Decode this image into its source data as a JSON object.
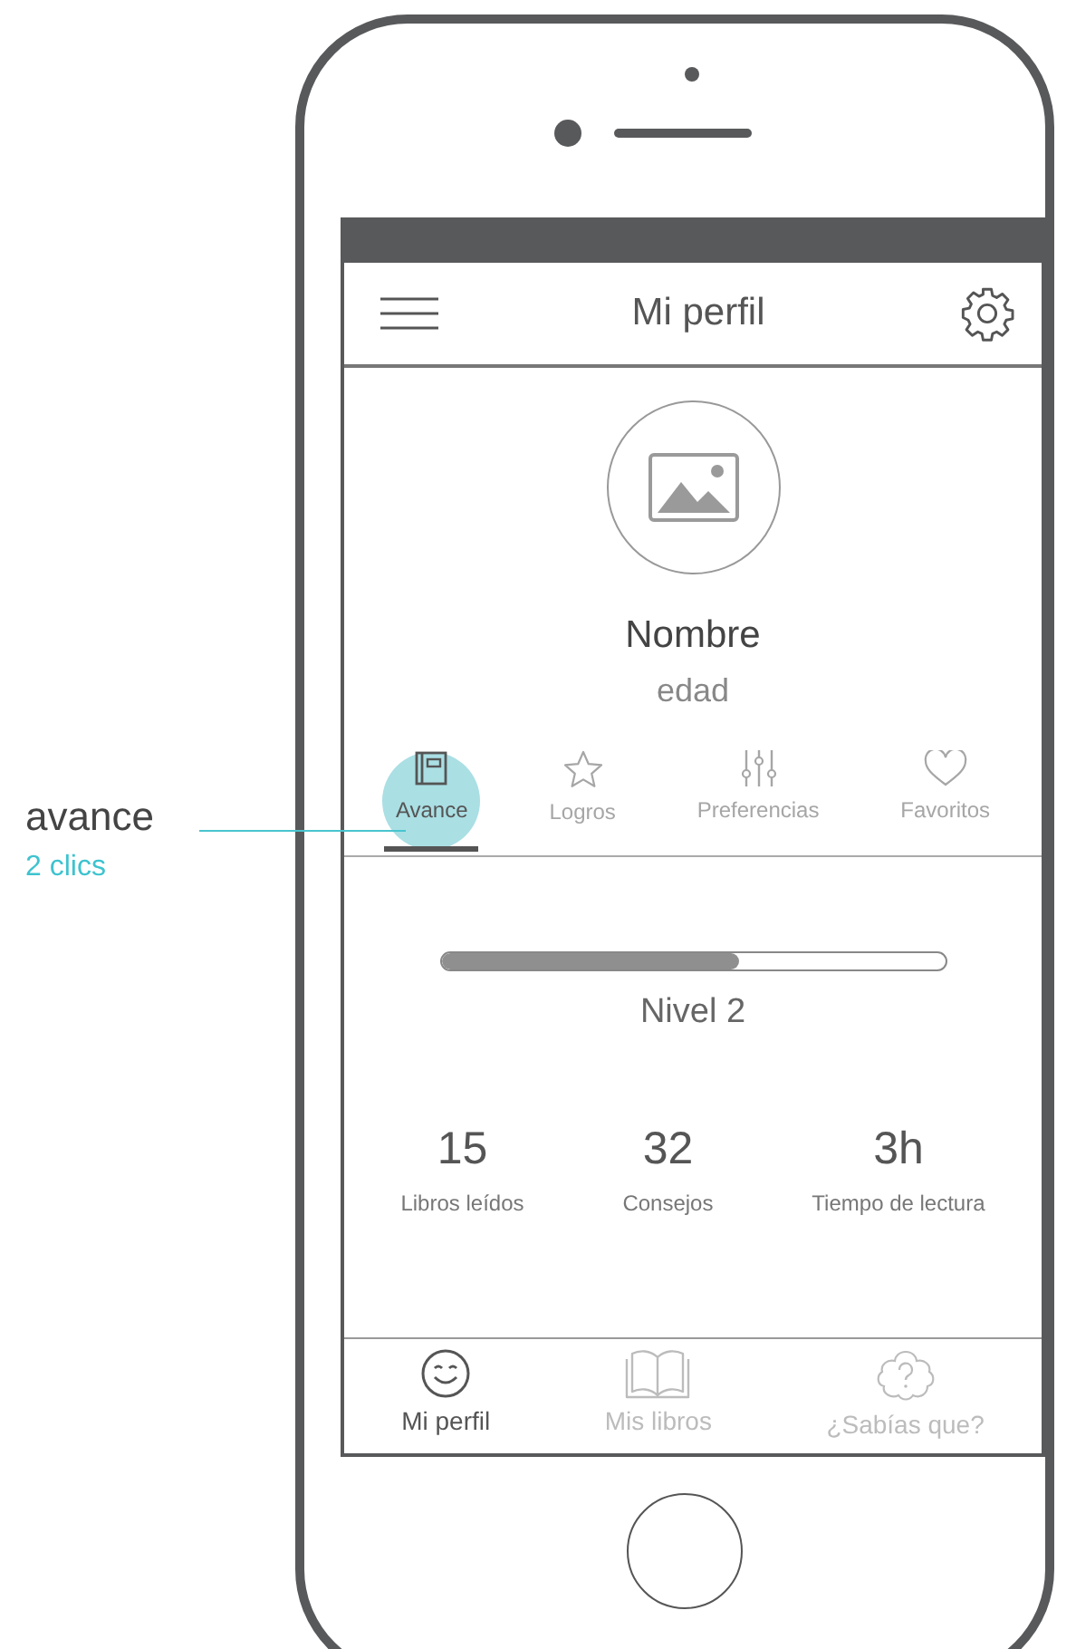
{
  "annotation": {
    "label": "avance",
    "note": "2 clics"
  },
  "header": {
    "title": "Mi perfil"
  },
  "profile": {
    "name": "Nombre",
    "age": "edad"
  },
  "tabs": [
    {
      "label": "Avance",
      "kind": "notebook",
      "selected": true,
      "highlighted": true
    },
    {
      "label": "Logros",
      "kind": "star",
      "selected": false,
      "highlighted": false
    },
    {
      "label": "Preferencias",
      "kind": "sliders",
      "selected": false,
      "highlighted": false
    },
    {
      "label": "Favoritos",
      "kind": "heart",
      "selected": false,
      "highlighted": false
    }
  ],
  "progress": {
    "level": 0.59,
    "label": "Nivel 2"
  },
  "stats": [
    {
      "value": "15",
      "label": "Libros leídos"
    },
    {
      "value": "32",
      "label": "Consejos"
    },
    {
      "value": "3h",
      "label": "Tiempo de lectura"
    }
  ],
  "nav": [
    {
      "label": "Mi perfil",
      "kind": "smile",
      "selected": true
    },
    {
      "label": "Mis libros",
      "kind": "book",
      "selected": false
    },
    {
      "label": "¿Sabías que?",
      "kind": "question",
      "selected": false
    }
  ]
}
